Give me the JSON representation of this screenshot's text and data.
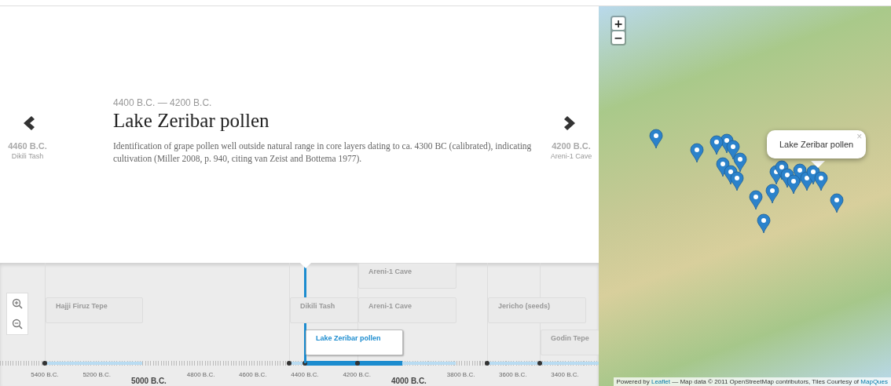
{
  "story": {
    "date_range": "4400 B.C. — 4200 B.C.",
    "title": "Lake Zeribar pollen",
    "description": "Identification of grape pollen well outside natural range in core layers dating to ca. 4300 BC (calibrated), indicating cultivation (Miller 2008, p. 940, citing van Zeist and Bottema 1977)."
  },
  "nav": [
    {
      "kind": "prev",
      "date": "4460 B.C.",
      "label": "Dikili Tash"
    },
    {
      "kind": "next",
      "date": "4200 B.C.",
      "label": "Areni-1 Cave"
    }
  ],
  "timeline": {
    "items": [
      {
        "label": "Areni-1 Cave",
        "selected": false
      },
      {
        "label": "Hajji Firuz Tepe",
        "selected": false
      },
      {
        "label": "Dikili Tash",
        "selected": false
      },
      {
        "label": "Areni-1 Cave",
        "selected": false
      },
      {
        "label": "Jericho (seeds)",
        "selected": false
      },
      {
        "label": "Lake Zeribar pollen",
        "selected": true
      },
      {
        "label": "Godin Tepe",
        "selected": false
      }
    ],
    "axis": [
      {
        "label": "5400 B.C.",
        "kind": "minor"
      },
      {
        "label": "5200 B.C.",
        "kind": "minor"
      },
      {
        "label": "5000 B.C.",
        "kind": "major"
      },
      {
        "label": "4800 B.C.",
        "kind": "minor"
      },
      {
        "label": "4600 B.C.",
        "kind": "minor"
      },
      {
        "label": "4400 B.C.",
        "kind": "minor"
      },
      {
        "label": "4200 B.C.",
        "kind": "minor"
      },
      {
        "label": "4000 B.C.",
        "kind": "major"
      },
      {
        "label": "3800 B.C.",
        "kind": "minor"
      },
      {
        "label": "3600 B.C.",
        "kind": "minor"
      },
      {
        "label": "3400 B.C.",
        "kind": "minor"
      }
    ]
  },
  "map": {
    "zoom": [
      "+",
      "−"
    ],
    "popup": {
      "title": "Lake Zeribar pollen",
      "close": "×"
    },
    "attribution": [
      {
        "kind": "text",
        "text": "Powered by "
      },
      {
        "kind": "link",
        "text": "Leaflet"
      },
      {
        "kind": "text",
        "text": " — Map data © 2011 OpenStreetMap contributors, Tiles Courtesy of "
      },
      {
        "kind": "link",
        "text": "MapQues"
      }
    ]
  }
}
